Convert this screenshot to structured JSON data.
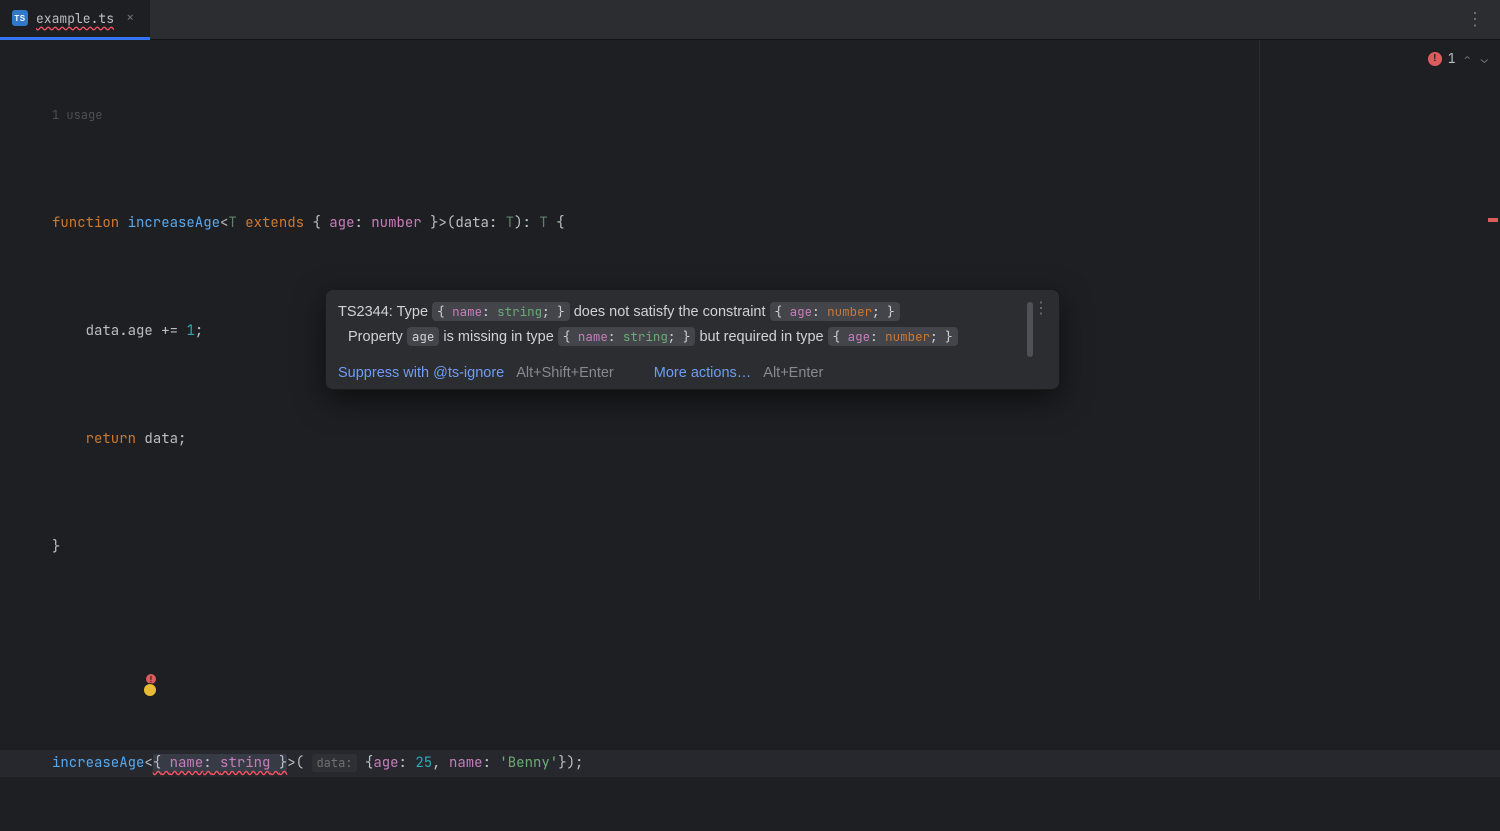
{
  "tab": {
    "icon_label": "TS",
    "filename": "example.ts",
    "close_glyph": "×"
  },
  "editor": {
    "usage_hint": "1 usage",
    "inspection": {
      "error_glyph": "!",
      "count": "1",
      "up": "⌃",
      "down": "⌄"
    },
    "code": {
      "l1": {
        "kw_function": "function",
        "fn": "increaseAge",
        "generic_open": "<",
        "tparam": "T",
        "kw_extends": "extends",
        "brace_open": "{",
        "prop_age": "age",
        "colon": ":",
        "type_number": "number",
        "brace_close": "}",
        "generic_close": ">",
        "paren_open": "(",
        "param": "data",
        "type_T": "T",
        "paren_close": ")",
        "ret_colon": ":",
        "ret_T": "T",
        "body_open": "{"
      },
      "l2": {
        "indent": "    ",
        "expr_left": "data.age",
        "op": "+=",
        "val": "1",
        "semi": ";"
      },
      "l3": {
        "indent": "    ",
        "kw_return": "return",
        "ident": "data",
        "semi": ";"
      },
      "l4": {
        "brace": "}"
      },
      "l6": {
        "call": "increaseAge",
        "lt": "<",
        "err_open": "{",
        "err_name": "name",
        "err_colon": ":",
        "err_string": "string",
        "err_close": "}",
        "gt": ">",
        "paren_open": "(",
        "hint": "data:",
        "obj_open": "{",
        "p_age": "age",
        "c1": ":",
        "v_age": "25",
        "comma": ",",
        "p_name": "name",
        "c2": ":",
        "v_name": "'Benny'",
        "obj_close": "}",
        "paren_close": ")",
        "semi": ";"
      }
    }
  },
  "popup": {
    "msg_code": "TS2344:",
    "msg_p1": "Type",
    "code1_name": "name",
    "code1_type": "string",
    "msg_p2": "does not satisfy the constraint",
    "code2_name": "age",
    "code2_type": "number",
    "line2_p1": "Property",
    "line2_code1": "age",
    "line2_p2": "is missing in type",
    "line2_code2_name": "name",
    "line2_code2_type": "string",
    "line2_p3": "but required in type",
    "line2_code3_name": "age",
    "line2_code3_type": "number",
    "action_suppress": "Suppress with @ts-ignore",
    "shortcut_suppress": "Alt+Shift+Enter",
    "action_more": "More actions…",
    "shortcut_more": "Alt+Enter",
    "more_glyph": "⋮"
  },
  "toolbar": {
    "more_glyph": "⋮"
  }
}
